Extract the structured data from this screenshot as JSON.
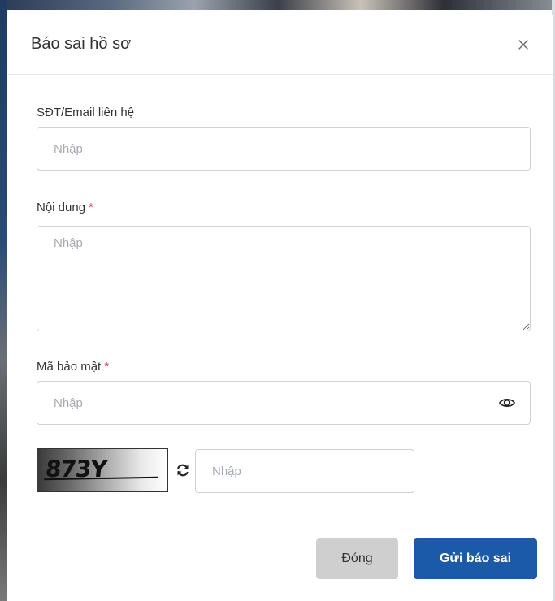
{
  "modal": {
    "title": "Báo sai hồ sơ",
    "close_icon": "close-icon"
  },
  "form": {
    "contact": {
      "label": "SĐT/Email liên hệ",
      "placeholder": "Nhập",
      "value": ""
    },
    "content": {
      "label": "Nội dung",
      "required_mark": "*",
      "placeholder": "Nhập",
      "value": ""
    },
    "security_code": {
      "label": "Mã bảo mật",
      "required_mark": "*",
      "placeholder": "Nhập",
      "value": "",
      "toggle_icon": "eye-icon"
    },
    "captcha": {
      "image_text": "873Y",
      "refresh_icon": "refresh-icon",
      "placeholder": "Nhập",
      "value": ""
    }
  },
  "footer": {
    "close_label": "Đóng",
    "submit_label": "Gửi báo sai"
  },
  "colors": {
    "primary": "#1a5aa6",
    "required": "#e53935",
    "secondary_button": "#cfcfcf",
    "border": "#cfd3d8"
  }
}
